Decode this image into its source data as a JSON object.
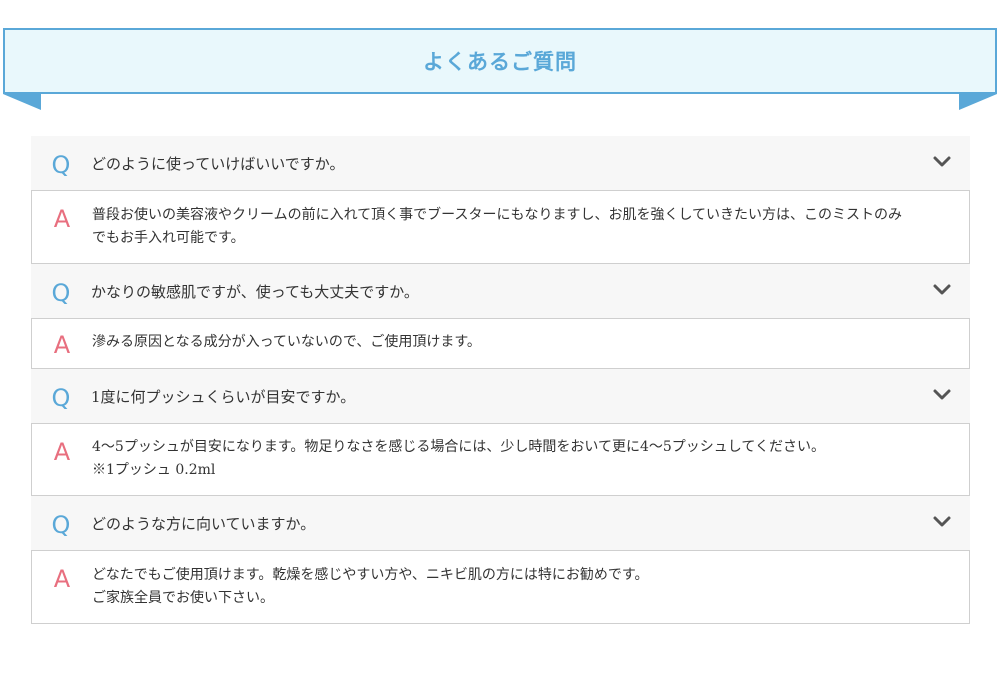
{
  "header": {
    "title": "よくあるご質問",
    "color": "#5aa8d8",
    "background": "#e9f8fc"
  },
  "faq": {
    "q_mark": "Q",
    "a_mark": "A",
    "items": [
      {
        "question": "どのように使っていけばいいですか。",
        "answer_lines": [
          "普段お使いの美容液やクリームの前に入れて頂く事でブースターにもなりますし、お肌を強くしていきたい方は、このミストのみ",
          "でもお手入れ可能です。"
        ]
      },
      {
        "question": "かなりの敏感肌ですが、使っても大丈夫ですか。",
        "answer_lines": [
          "滲みる原因となる成分が入っていないので、ご使用頂けます。"
        ]
      },
      {
        "question": "1度に何プッシュくらいが目安ですか。",
        "answer_lines": [
          "4～5プッシュが目安になります。物足りなさを感じる場合には、少し時間をおいて更に4～5プッシュしてください。",
          "※1プッシュ 0.2ml"
        ]
      },
      {
        "question": "どのような方に向いていますか。",
        "answer_lines": [
          "どなたでもご使用頂けます。乾燥を感じやすい方や、ニキビ肌の方には特にお勧めです。",
          "ご家族全員でお使い下さい。"
        ]
      }
    ],
    "colors": {
      "q_mark": "#5aa8d8",
      "a_mark": "#e86f7f",
      "question_bg": "#f7f7f7",
      "answer_border": "#cfcfcf"
    },
    "toggle_icon": "chevron-down-icon"
  }
}
